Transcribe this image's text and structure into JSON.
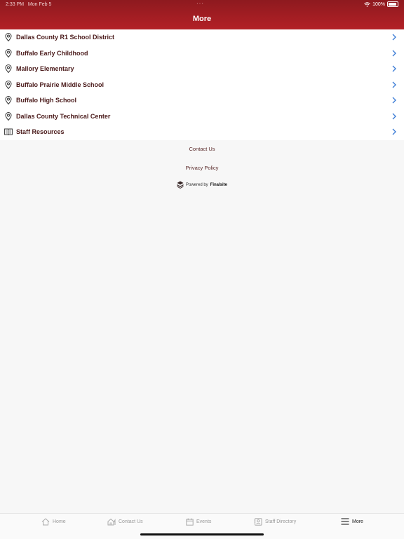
{
  "status": {
    "time": "2:33 PM",
    "date": "Mon Feb 5",
    "battery": "100%"
  },
  "header": {
    "title": "More"
  },
  "menu": [
    {
      "label": "Dallas County R1 School District",
      "icon": "location-pin-icon"
    },
    {
      "label": "Buffalo Early Childhood",
      "icon": "location-pin-icon"
    },
    {
      "label": "Mallory Elementary",
      "icon": "location-pin-icon"
    },
    {
      "label": "Buffalo Prairie Middle School",
      "icon": "location-pin-icon"
    },
    {
      "label": "Buffalo High School",
      "icon": "location-pin-icon"
    },
    {
      "label": "Dallas County Technical Center",
      "icon": "location-pin-icon"
    },
    {
      "label": "Staff Resources",
      "icon": "book-icon"
    }
  ],
  "footer": {
    "contact": "Contact Us",
    "privacy": "Privacy Policy",
    "powered_prefix": "Powered by",
    "powered_brand": "Finalsite"
  },
  "tabs": [
    {
      "label": "Home",
      "icon": "home-icon",
      "active": false
    },
    {
      "label": "Contact Us",
      "icon": "contact-house-icon",
      "active": false
    },
    {
      "label": "Events",
      "icon": "calendar-icon",
      "active": false
    },
    {
      "label": "Staff Directory",
      "icon": "contact-card-icon",
      "active": false
    },
    {
      "label": "More",
      "icon": "menu-icon",
      "active": true
    }
  ],
  "colors": {
    "header": "#a51e24",
    "text": "#4a1a1a",
    "chevron": "#3a7bd5"
  }
}
